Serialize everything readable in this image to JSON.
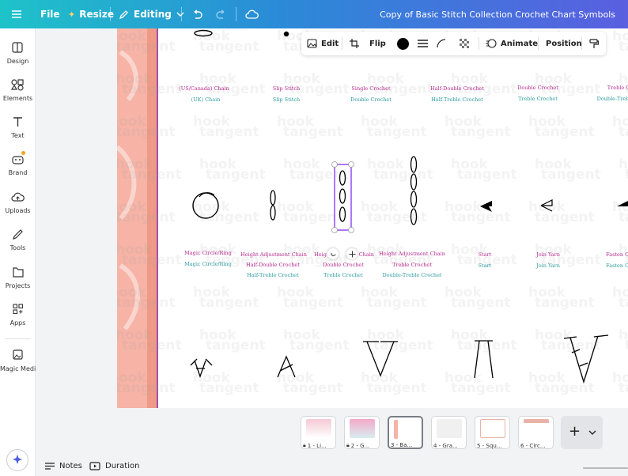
{
  "topbar": {
    "file": "File",
    "resize": "Resize",
    "editing": "Editing",
    "doc_title": "Copy of Basic Stitch Collection Crochet Chart Symbols"
  },
  "sidebar": {
    "items": [
      {
        "label": "Design",
        "icon": "design-icon"
      },
      {
        "label": "Elements",
        "icon": "elements-icon"
      },
      {
        "label": "Text",
        "icon": "text-icon"
      },
      {
        "label": "Brand",
        "icon": "brand-icon"
      },
      {
        "label": "Uploads",
        "icon": "uploads-icon"
      },
      {
        "label": "Tools",
        "icon": "tools-icon"
      },
      {
        "label": "Projects",
        "icon": "projects-icon"
      },
      {
        "label": "Apps",
        "icon": "apps-icon"
      },
      {
        "label": "Magic Media",
        "icon": "magic-media-icon"
      }
    ]
  },
  "toolbar": {
    "edit": "Edit",
    "flip": "Flip",
    "animate": "Animate",
    "position": "Position"
  },
  "canvas": {
    "watermark": "hook tangent",
    "row1": [
      {
        "line1": "(US/Canada) Chain",
        "line2": "(UK) Chain"
      },
      {
        "line1": "Slip Stitch",
        "line2": "Slip Stitch"
      },
      {
        "line1": "Single Crochet",
        "line2": "Double Crochet"
      },
      {
        "line1": "Half-Double Crochet",
        "line2": "Half-Treble Crochet"
      },
      {
        "line1": "Double Crochet",
        "line2": "Treble Crochet"
      },
      {
        "line1": "Treble C",
        "line2": "Double-Treble"
      }
    ],
    "row2": [
      {
        "line1": "Magic Circle/Ring",
        "line2": "Magic Circle/Ring"
      },
      {
        "line1": "Height Adjustment Chain",
        "line2": "Half-Double Crochet",
        "line3": "Half-Treble Crochet"
      },
      {
        "line1": "Heig",
        "line1b": "t Chain",
        "line2": "Double Crochet",
        "line3": "Treble Crochet"
      },
      {
        "line1": "Height Adjustment Chain",
        "line2": "Treble Crochet",
        "line3": "Double-Treble Crochet"
      },
      {
        "line1": "Start",
        "line2": "Start"
      },
      {
        "line1": "Join Yarn",
        "line2": "Join Yarn"
      },
      {
        "line1": "Fasten Of",
        "line2": "Fasten Of"
      }
    ]
  },
  "pages": [
    {
      "label": "1 - Li...",
      "locked": true
    },
    {
      "label": "2 - G...",
      "locked": true
    },
    {
      "label": "3 - Ba...",
      "locked": false,
      "active": true
    },
    {
      "label": "4 - Gra...",
      "locked": false
    },
    {
      "label": "5 - Squ...",
      "locked": false
    },
    {
      "label": "6 - Circ...",
      "locked": false
    }
  ],
  "footer": {
    "notes": "Notes",
    "duration": "Duration"
  },
  "colors": {
    "accent_teal": "#1ec3c9",
    "accent_purple": "#5a5fe0",
    "label_magenta": "#b32a8d",
    "label_teal": "#2e9b9e",
    "stripe_pink": "#f6b3a6",
    "stripe_salmon": "#ee9a86",
    "selection": "#8b3dff"
  }
}
